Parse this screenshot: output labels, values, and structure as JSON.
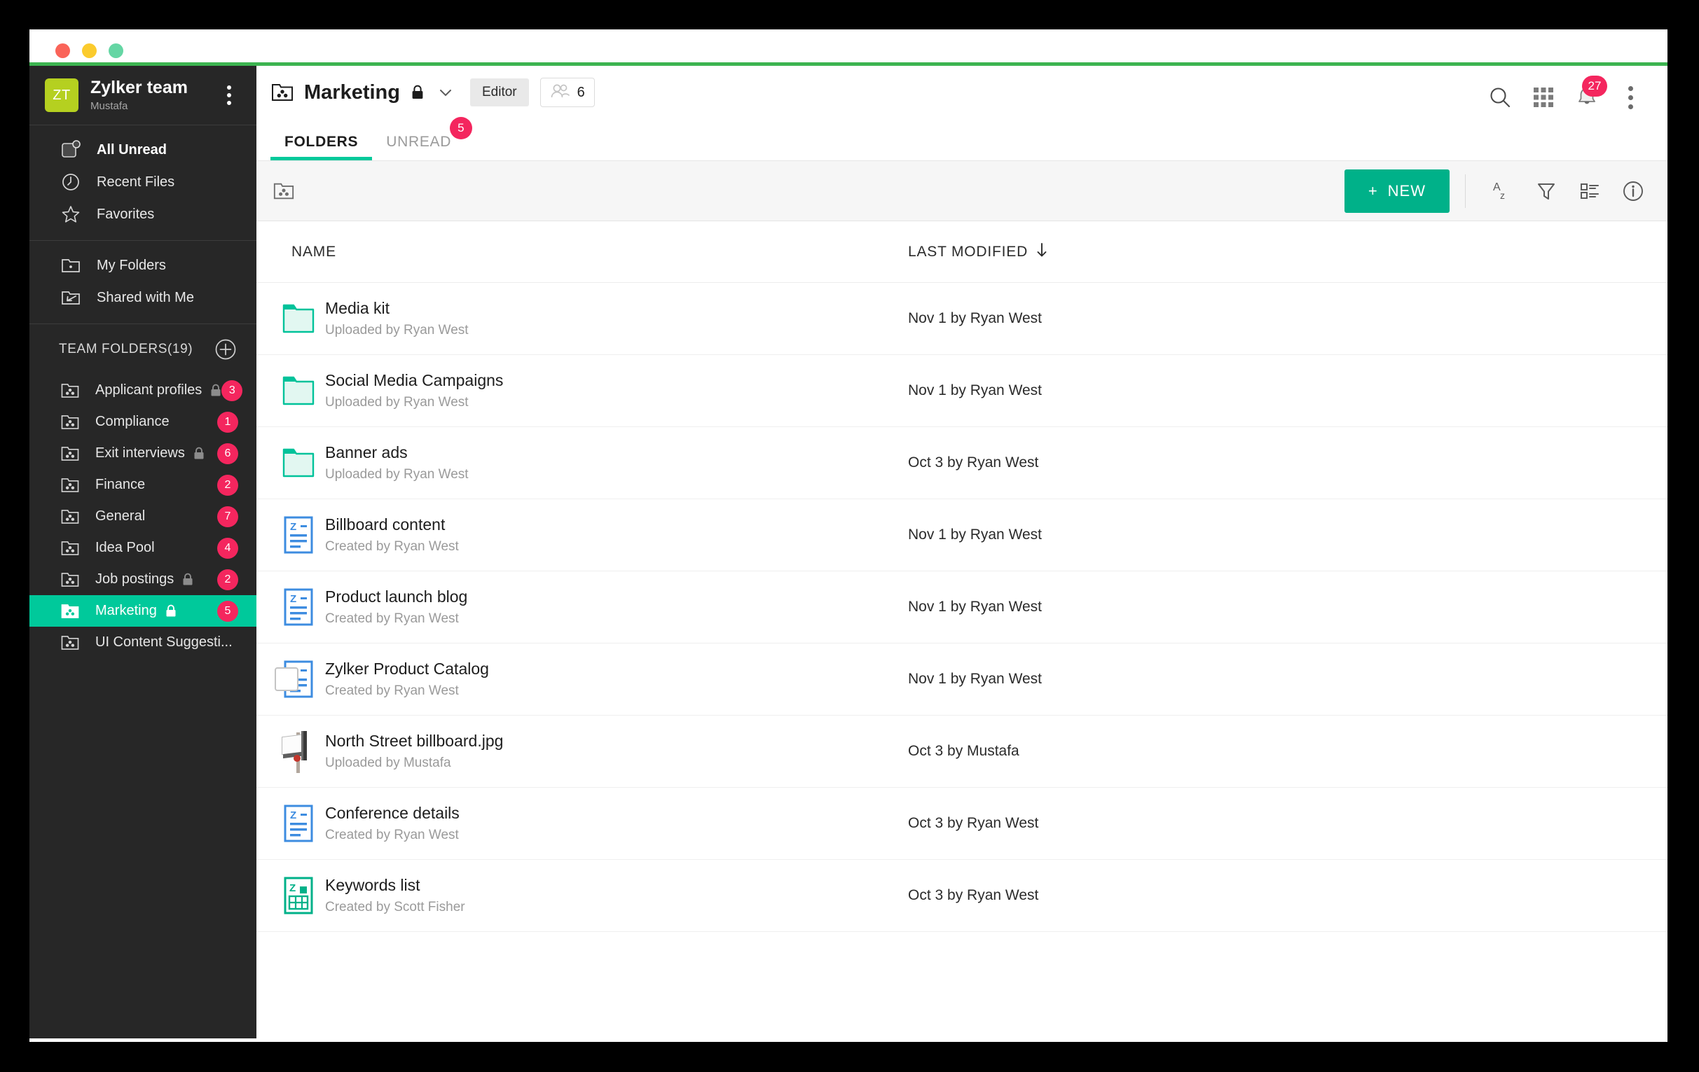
{
  "window": {
    "traffic_lights": [
      "close",
      "minimize",
      "zoom"
    ],
    "accent_green": "#3cb450"
  },
  "sidebar": {
    "team": {
      "avatar_initials": "ZT",
      "name": "Zylker team",
      "user": "Mustafa",
      "menu_icon": "kebab-menu-icon"
    },
    "nav_primary": [
      {
        "label": "All Unread",
        "icon": "unread-square-icon"
      },
      {
        "label": "Recent Files",
        "icon": "clock-icon"
      },
      {
        "label": "Favorites",
        "icon": "star-icon"
      }
    ],
    "nav_secondary": [
      {
        "label": "My Folders",
        "icon": "my-folder-icon"
      },
      {
        "label": "Shared with Me",
        "icon": "shared-folder-icon"
      }
    ],
    "team_folders": {
      "title": "TEAM FOLDERS(19)",
      "add_icon": "plus-circle-icon",
      "items": [
        {
          "label": "Applicant profiles",
          "locked": true,
          "count": "3",
          "active": false
        },
        {
          "label": "Compliance",
          "locked": false,
          "count": "1",
          "active": false
        },
        {
          "label": "Exit interviews",
          "locked": true,
          "count": "6",
          "active": false
        },
        {
          "label": "Finance",
          "locked": false,
          "count": "2",
          "active": false
        },
        {
          "label": "General",
          "locked": false,
          "count": "7",
          "active": false
        },
        {
          "label": "Idea Pool",
          "locked": false,
          "count": "4",
          "active": false
        },
        {
          "label": "Job postings",
          "locked": true,
          "count": "2",
          "active": false
        },
        {
          "label": "Marketing",
          "locked": true,
          "count": "5",
          "active": true
        },
        {
          "label": "UI Content Suggesti...",
          "locked": false,
          "count": "",
          "active": false
        }
      ]
    }
  },
  "header": {
    "folder_icon": "team-folder-icon",
    "title": "Marketing",
    "locked": true,
    "chevron_icon": "chevron-down-icon",
    "role_label": "Editor",
    "members_icon": "members-icon",
    "members_count": "6",
    "actions": [
      {
        "name": "search-icon"
      },
      {
        "name": "apps-grid-icon"
      },
      {
        "name": "bell-icon",
        "badge": "27"
      },
      {
        "name": "kebab-menu-icon"
      }
    ],
    "tabs": [
      {
        "label": "FOLDERS",
        "active": true,
        "badge": ""
      },
      {
        "label": "UNREAD",
        "active": false,
        "badge": "5"
      }
    ]
  },
  "action_bar": {
    "breadcrumb_icon": "team-folder-icon",
    "new_label": "NEW",
    "new_plus": "+",
    "tools": [
      {
        "name": "sort-az-icon"
      },
      {
        "name": "filter-icon"
      },
      {
        "name": "view-list-icon"
      },
      {
        "name": "info-icon"
      }
    ]
  },
  "table": {
    "columns": [
      {
        "label": "NAME"
      },
      {
        "label": "LAST MODIFIED",
        "sort_icon": "arrow-down-icon"
      }
    ],
    "rows": [
      {
        "name": "Media kit",
        "sub": "Uploaded by Ryan West",
        "modified": "Nov 1 by Ryan West",
        "icon": "folder-green-icon",
        "checked": false,
        "checkbox": false
      },
      {
        "name": "Social Media Campaigns",
        "sub": "Uploaded by Ryan West",
        "modified": "Nov 1 by Ryan West",
        "icon": "folder-green-icon",
        "checked": false,
        "checkbox": false
      },
      {
        "name": "Banner ads",
        "sub": "Uploaded by Ryan West",
        "modified": "Oct 3 by Ryan West",
        "icon": "folder-green-icon",
        "checked": false,
        "checkbox": false
      },
      {
        "name": "Billboard content",
        "sub": "Created by Ryan West",
        "modified": "Nov 1 by Ryan West",
        "icon": "writer-doc-icon",
        "checked": false,
        "checkbox": false
      },
      {
        "name": "Product launch blog",
        "sub": "Created by Ryan West",
        "modified": "Nov 1 by Ryan West",
        "icon": "writer-doc-icon",
        "checked": false,
        "checkbox": false
      },
      {
        "name": "Zylker Product Catalog",
        "sub": "Created by Ryan West",
        "modified": "Nov 1 by Ryan West",
        "icon": "writer-doc-icon",
        "checked": false,
        "checkbox": true
      },
      {
        "name": "North Street billboard.jpg",
        "sub": "Uploaded by Mustafa",
        "modified": "Oct 3 by Mustafa",
        "icon": "image-thumb-icon",
        "checked": false,
        "checkbox": false
      },
      {
        "name": "Conference details",
        "sub": "Created by Ryan West",
        "modified": "Oct 3 by Ryan West",
        "icon": "writer-doc-icon",
        "checked": false,
        "checkbox": false
      },
      {
        "name": "Keywords list",
        "sub": "Created by Scott Fisher",
        "modified": "Oct 3 by Ryan West",
        "icon": "sheet-doc-icon",
        "checked": false,
        "checkbox": false
      }
    ]
  },
  "colors": {
    "accent_teal": "#00c99b",
    "new_button": "#00b189",
    "badge_pink": "#f4265e",
    "sidebar_bg": "#272727",
    "avatar_green": "#b5d020",
    "doc_blue": "#3d8ce0",
    "sheet_green": "#00b189",
    "folder_green": "#00c29a",
    "title_accent": "#3cb450"
  }
}
